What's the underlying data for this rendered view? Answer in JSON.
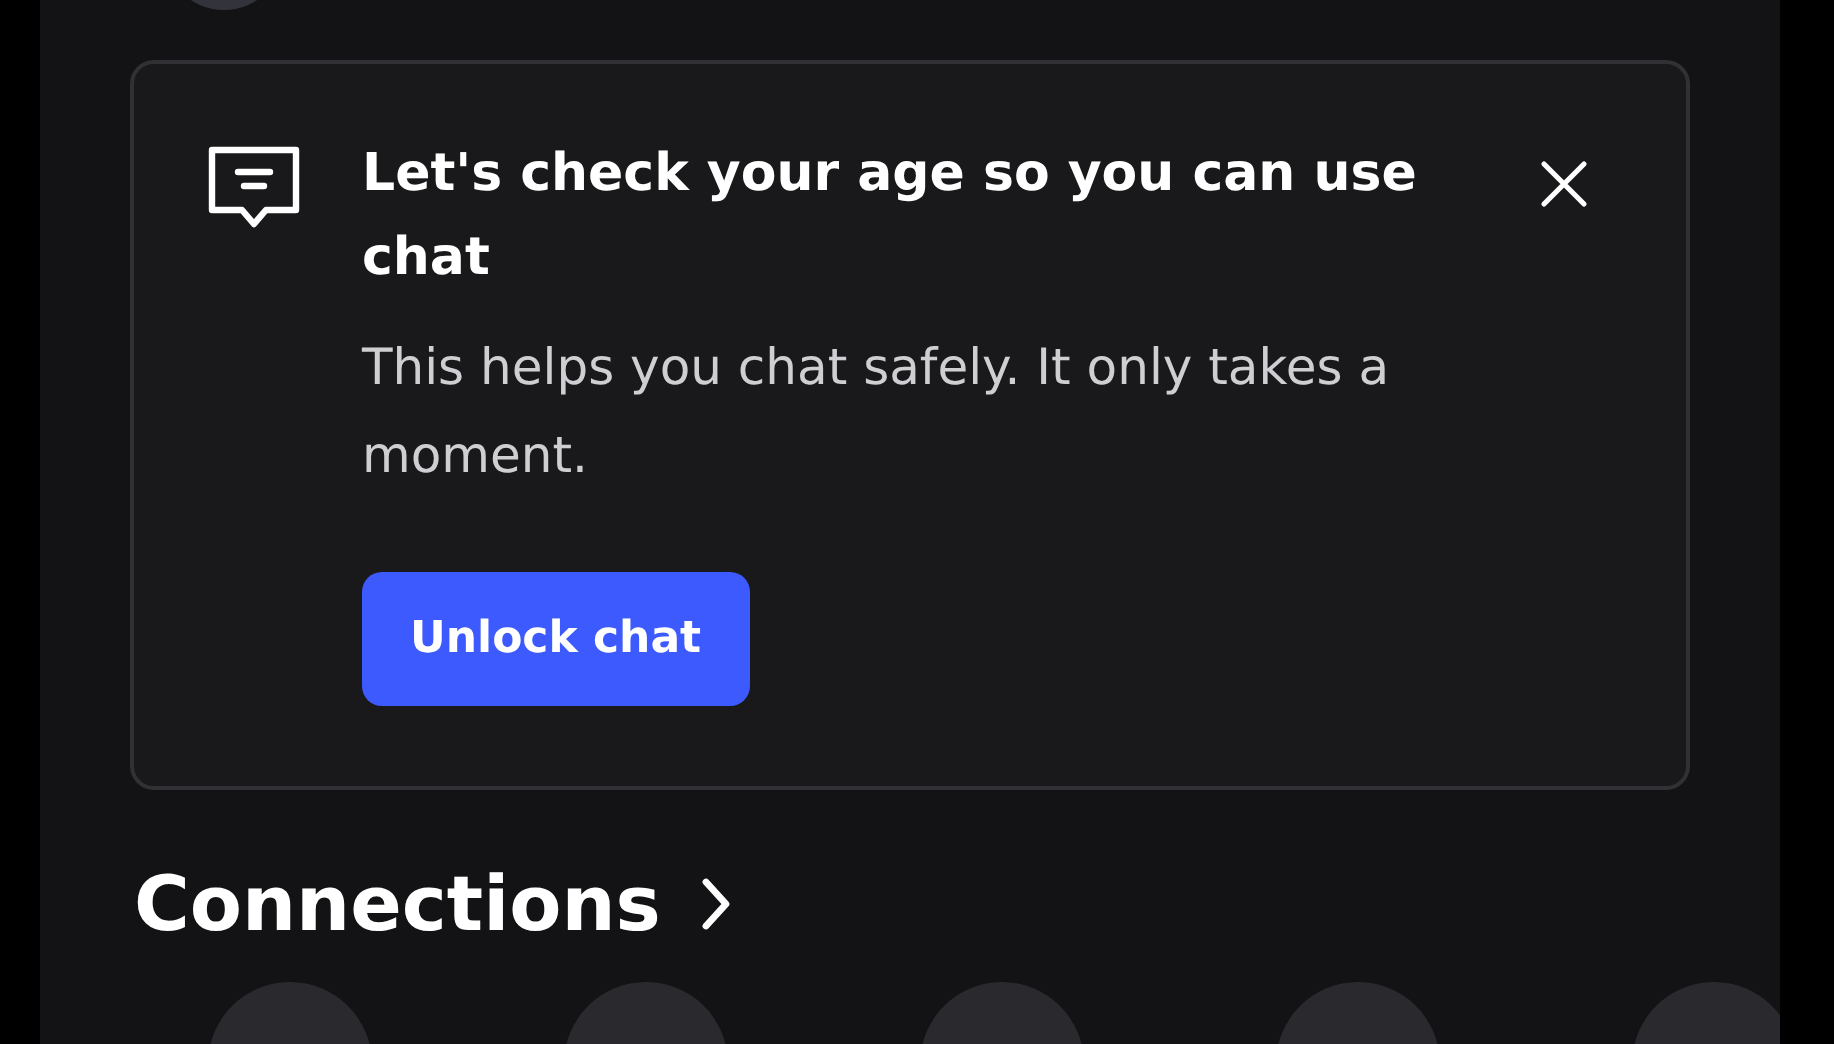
{
  "age_check_card": {
    "title": "Let's check your age so you can use chat",
    "message": "This helps you chat safely. It only takes a moment.",
    "button": "Unlock chat"
  },
  "connections": {
    "heading": "Connections"
  }
}
